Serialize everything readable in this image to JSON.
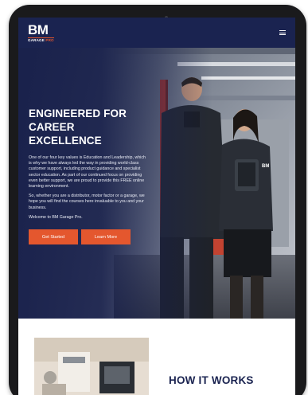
{
  "brand": {
    "logo_mark": "BM",
    "logo_sub": "GARAGE",
    "logo_sub_accent": "PRO"
  },
  "hero": {
    "title_line1": "ENGINEERED FOR",
    "title_line2": "CAREER EXCELLENCE",
    "paragraph1": "One of our four key values is Education and Leadership, which is why we have always led the way in providing world-class customer support, including product guidance and specialist sector education. As part of our continued focus on providing even better support, we are proud to provide this FREE online learning environment.",
    "paragraph2": "So, whether you are a distributor, motor factor or a garage, we hope you will find the courses here invaluable to you and your business.",
    "paragraph3": "Welcome to BM Garage Pro.",
    "primary_button": "Get Started",
    "secondary_button": "Learn More",
    "vest_logo": "BM"
  },
  "section_two": {
    "title": "HOW IT WORKS"
  },
  "colors": {
    "navy": "#1a2350",
    "accent": "#e4572e",
    "white": "#ffffff"
  },
  "icons": {
    "menu": "hamburger-menu-icon"
  }
}
